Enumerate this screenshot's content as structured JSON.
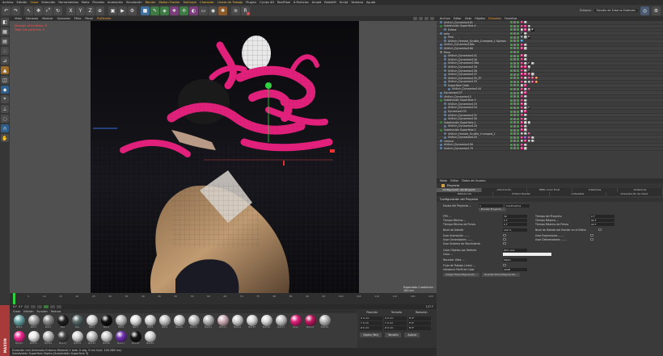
{
  "menubar": {
    "items": [
      "Archivo",
      "Edición",
      "Crear",
      "Selección",
      "Herramientas",
      "Malla",
      "Pinceles",
      "Animación",
      "Simulación",
      "Render",
      "Motion Tracker",
      "MoGraph",
      "Character",
      "Líneas de Trabajo",
      "Plugins",
      "Cycles 4D",
      "RealFlow",
      "X-Particles",
      "Arnold",
      "Redshift",
      "Script",
      "Ventana",
      "Ayuda"
    ],
    "highlighted": [
      "Crear",
      "Render",
      "Motion Tracker",
      "MoGraph",
      "Character",
      "Líneas de Trabajo"
    ],
    "right_label": "Entorno:",
    "right_value": "Estudio de Entorno Estándar"
  },
  "viewport": {
    "menu": [
      "Vista",
      "Cámaras",
      "Mostrar",
      "Opciones",
      "Filtro",
      "Panel",
      "ProRender"
    ],
    "active_menu": "ProRender",
    "hud_line1": "Number of emitters: 6",
    "hud_line2": "Total live particles: 0",
    "footer": "Espaciado Cuadrícula : 100 cm"
  },
  "timeline": {
    "ticks": [
      "0",
      "5",
      "10",
      "15",
      "20",
      "25",
      "30",
      "35",
      "40",
      "45",
      "50",
      "55",
      "60",
      "65",
      "70",
      "75",
      "80",
      "85",
      "90",
      "95",
      "100",
      "105",
      "110",
      "115",
      "120",
      "125"
    ],
    "start": "0 F",
    "end": "127 F",
    "current": "0 F"
  },
  "materials": {
    "menu": [
      "Crear",
      "Edición",
      "Función",
      "Textura"
    ],
    "items": [
      {
        "name": "Mat.4",
        "color": "#6aa6a6"
      },
      {
        "name": "Mat.3",
        "color": "#a9a9a9"
      },
      {
        "name": "Mat.2",
        "color": "#8c8c8c"
      },
      {
        "name": "Mat",
        "color": "#202020"
      },
      {
        "name": "Pelo",
        "color": "#5a6a6a"
      },
      {
        "name": "Mat.1",
        "color": "#d8d8d8"
      },
      {
        "name": "Mat.5",
        "color": "#101010"
      },
      {
        "name": "Mat.6",
        "color": "#bdbdbd"
      },
      {
        "name": "Mat.7",
        "color": "#e0e0e0"
      },
      {
        "name": "Mat.8",
        "color": "#d5d5d5"
      },
      {
        "name": "Mat.9",
        "color": "#c8c8c8"
      },
      {
        "name": "Mat.10",
        "color": "#d0d0d0"
      },
      {
        "name": "Mat.11",
        "color": "#c0c0c0"
      },
      {
        "name": "Mat.12",
        "color": "#b8b8b8"
      },
      {
        "name": "Mat.13",
        "color": "#d0b0b8"
      },
      {
        "name": "Mat.14",
        "color": "#cfcfcf"
      },
      {
        "name": "Mat.15",
        "color": "#d8d8d8"
      },
      {
        "name": "Mat.16",
        "color": "#dadada"
      },
      {
        "name": "Mat.17",
        "color": "#c6c6c6"
      },
      {
        "name": "Rosa",
        "color": "#e0207a"
      },
      {
        "name": "Mat.18",
        "color": "#c01860"
      },
      {
        "name": "Mat.19",
        "color": "#b8b8b8"
      },
      {
        "name": "Mat.20",
        "color": "#f02a90"
      },
      {
        "name": "Mat.21",
        "color": "#e8e8e8"
      },
      {
        "name": "Mat.22",
        "color": "#bcbcbc"
      },
      {
        "name": "Mat.23",
        "color": "#444"
      },
      {
        "name": "Mat.24",
        "color": "#d8d8d8"
      },
      {
        "name": "Mat.25",
        "color": "#c4c4c4"
      },
      {
        "name": "Mat.26",
        "color": "#d0d0d0"
      },
      {
        "name": "Mat.27",
        "color": "#7030b0"
      },
      {
        "name": "Mat.28",
        "color": "#151515"
      },
      {
        "name": "Mat.29",
        "color": "#d8d8d8"
      }
    ]
  },
  "coords": {
    "headers": [
      "Posición",
      "Tamaño",
      "Rotación"
    ],
    "rows": [
      [
        "X  0 cm",
        "X  0 cm",
        "H  0°"
      ],
      [
        "Y  0 cm",
        "Y  0 cm",
        "P  0°"
      ],
      [
        "Z  0 cm",
        "Z  0 cm",
        "B  0°"
      ]
    ],
    "mode": "Objeto (Rel)",
    "size_mode": "Tamaño",
    "apply": "Aplicar"
  },
  "status": {
    "line1": "Duración real (Intervalo Entorno Material 2 leds: 0 seg, 0 ms hr/s/: 100.266 ms)",
    "line2": "Subdivisión Superficie Objeto [Subdivisión Superficie 3]"
  },
  "objects": {
    "menu": [
      "Archivo",
      "Editar",
      "Vista",
      "Objetos",
      "Etiquetas",
      "Favoritos"
    ],
    "active_menu": "Etiquetas",
    "rows": [
      {
        "name": "Uhlitch_Dynamise161",
        "depth": 0,
        "tags": [
          "#e0207a",
          "#c0c0c0"
        ]
      },
      {
        "name": "Subdivisión Superficie.4",
        "depth": 0,
        "tags": [
          "#e0207a",
          "#e0207a",
          "#c0c0c0"
        ]
      },
      {
        "name": "Esfera",
        "depth": 1,
        "tags": [
          "#c0c0c0",
          "#e0207a",
          "#c0c0c0",
          "#202020"
        ]
      },
      {
        "name": "pelo",
        "depth": 0,
        "tags": [
          "#202020",
          "#c0c0c0"
        ]
      },
      {
        "name": "Pelo",
        "depth": 1,
        "tags": [
          "#5a6a6a",
          "#c0c0c0",
          "#202020"
        ]
      },
      {
        "name": "Uhlitch_Female_Scuttle_Cramped_1 Splines",
        "depth": 1,
        "tags": [
          "#3aa0ff"
        ]
      },
      {
        "name": "Uhlitch_Dynamise160s",
        "depth": 0,
        "tags": [
          "#e0207a",
          "#c0c0c0"
        ]
      },
      {
        "name": "Uhlitch_Dynamise160",
        "depth": 0,
        "tags": [
          "#e0207a",
          "#c0c0c0"
        ]
      },
      {
        "name": "Rosa",
        "depth": 0,
        "tags": []
      },
      {
        "name": "Uhlitch_Dynamise141",
        "depth": 1,
        "tags": [
          "#e0207a",
          "#c0c0c0"
        ]
      },
      {
        "name": "Uhlitch_Dynamise140",
        "depth": 1,
        "tags": [
          "#e0207a",
          "#c0c0c0"
        ]
      },
      {
        "name": "Uhlitch_Dynamise136d",
        "depth": 1,
        "tags": [
          "#e0207a",
          "#c0c0c0",
          "#202020",
          "#c0c0c0"
        ]
      },
      {
        "name": "Uhlitch_Dynamise139",
        "depth": 1,
        "tags": [
          "#e0207a",
          "#e0207a",
          "#c0c0c0"
        ]
      },
      {
        "name": "Uhlitch_Dynamise138",
        "depth": 1,
        "tags": [
          "#e0207a",
          "#c0c0c0",
          "#202020"
        ]
      },
      {
        "name": "Uhlitch_Dynamise137",
        "depth": 1,
        "tags": [
          "#e0207a",
          "#e0207a",
          "#e0207a",
          "#c0c0c0"
        ]
      },
      {
        "name": "Uhlitch_Dynamise135_FF",
        "depth": 1,
        "tags": [
          "#e0207a",
          "#c0c0c0",
          "#e0207a",
          "#e0207a",
          "#f09030"
        ]
      },
      {
        "name": "Uhlitch_Dynamise135",
        "depth": 1,
        "tags": [
          "#e0207a",
          "#c0c0c0",
          "#c0c0c0",
          "#e0207a",
          "#f09030"
        ]
      },
      {
        "name": "Superficie Cloth",
        "depth": 1,
        "tags": [
          "#c0c0c0",
          "#e0207a"
        ]
      },
      {
        "name": "Uhlitch_Dynamise144",
        "depth": 2,
        "tags": [
          "#e0207a",
          "#c0c0c0",
          "#e0207a"
        ]
      },
      {
        "name": "Dynamise137",
        "depth": 0,
        "tags": [
          "#c0c0c0",
          "#e0207a"
        ]
      },
      {
        "name": "Uhlitch_Dynamise15",
        "depth": 0,
        "tags": [
          "#e0207a",
          "#c0c0c0"
        ]
      },
      {
        "name": "Subdivisión Superficie.3",
        "depth": 0,
        "tags": [
          "#e0207a",
          "#c0c0c0"
        ]
      },
      {
        "name": "Uhlitch_Dynamise133",
        "depth": 1,
        "tags": [
          "#e0207a",
          "#c0c0c0"
        ]
      },
      {
        "name": "Uhlitch_Dynamise134",
        "depth": 1,
        "tags": [
          "#e0207a",
          "#c0c0c0",
          "#202020"
        ]
      },
      {
        "name": "Dynamise133",
        "depth": 1,
        "tags": [
          "#c0c0c0",
          "#e0207a"
        ]
      },
      {
        "name": "Uhlitch_Dynamise131",
        "depth": 1,
        "tags": [
          "#e0207a",
          "#c0c0c0"
        ]
      },
      {
        "name": "Uhlitch_Dynamise130",
        "depth": 1,
        "tags": [
          "#e0207a",
          "#c0c0c0"
        ]
      },
      {
        "name": "Subdivisión Superficie.1",
        "depth": 0,
        "tags": [
          "#e0207a",
          "#c0c0c0",
          "#c0c0c0"
        ]
      },
      {
        "name": "Uhlitch_Dynamise120",
        "depth": 1,
        "tags": [
          "#e0207a",
          "#c0c0c0"
        ]
      },
      {
        "name": "Subdivisión Superficie.2",
        "depth": 0,
        "tags": [
          "#e0207a",
          "#c0c0c0"
        ]
      },
      {
        "name": "Uhlitch_Female_Scuttle_Cramped_1",
        "depth": 1,
        "tags": [
          "#c0c0c0",
          "#c0c0c0",
          "#e0207a"
        ]
      },
      {
        "name": "Uhlitch_Dynamise125",
        "depth": 1,
        "tags": [
          "#e0207a",
          "#7030b0",
          "#e0207a",
          "#c0c0c0"
        ]
      },
      {
        "name": "chanca",
        "depth": 0,
        "tags": [
          "#c0c0c0",
          "#e0207a",
          "#c0c0c0",
          "#c0c0c0"
        ]
      },
      {
        "name": "Uhlitch_Dynamise190",
        "depth": 0,
        "tags": [
          "#e0207a",
          "#c0c0c0"
        ]
      },
      {
        "name": "Uhlitch_Dynamise179",
        "depth": 0,
        "tags": [
          "#e0207a",
          "#c0c0c0"
        ]
      }
    ]
  },
  "attributes": {
    "menu": [
      "Modo",
      "Editar",
      "Datos de Usuario"
    ],
    "title": "Proyecto",
    "tabs_row1": [
      "Configuración del Proyecto",
      "Información",
      "MERL Color Frost",
      "X-Particles",
      "Dinámicas"
    ],
    "tabs_row2": [
      "Referencias",
      "Criterio Render",
      "A Nivelstar",
      "Interpolación de Clave"
    ],
    "active_tab": "Configuración del Proyecto",
    "section": "Configuración del Proyecto",
    "escala_label": "Escala del Proyecto ...",
    "escala_value": "1",
    "escala_unit": "Centímetros",
    "escalar_btn": "Escalar Proyecto...",
    "fps_label": "FPS ...",
    "fps_value": "30",
    "tiempo_proy_label": "Tiempo del Proyecto",
    "tiempo_proy_value": "0 F",
    "tmin_label": "Tiempo Mínimo ...",
    "tmin_value": "0 F",
    "tmax_label": "Tiempo Máximo ...",
    "tmax_value": "90 F",
    "tmin_prev_label": "Tiempo Mínimo de Previo",
    "tmin_prev_value": "0 F",
    "tmax_prev_label": "Tiempo Máximo de Previo",
    "tmax_prev_value": "90 F",
    "nivel_label": "Nivel de Detalle",
    "nivel_value": "100 %",
    "nivel_render_label": "Nivel de Detalle del Render en el Editor",
    "usar_anim": "Usar Animación .......",
    "usar_expr": "Usar Expresiones .......",
    "usar_gen": "Usar Generadores .......",
    "usar_def": "Usar Deformadores .......",
    "usar_movi": "Usar Sistema de Movimiento",
    "color_obj_label": "Color Objetos por Defecto",
    "color_obj_value": "80% Gris",
    "color_label": "Color ...",
    "recortar_label": "Recortar Vista ...",
    "recortar_value": "Medio",
    "flujo_label": "Flujo de Trabajo Lineal ...",
    "perfil_label": "Introducir Perfil de Color",
    "perfil_value": "sRGB",
    "cargar_btn": "Cargar Preconfiguración...",
    "guardar_btn": "Guardar Preconfiguración..."
  }
}
